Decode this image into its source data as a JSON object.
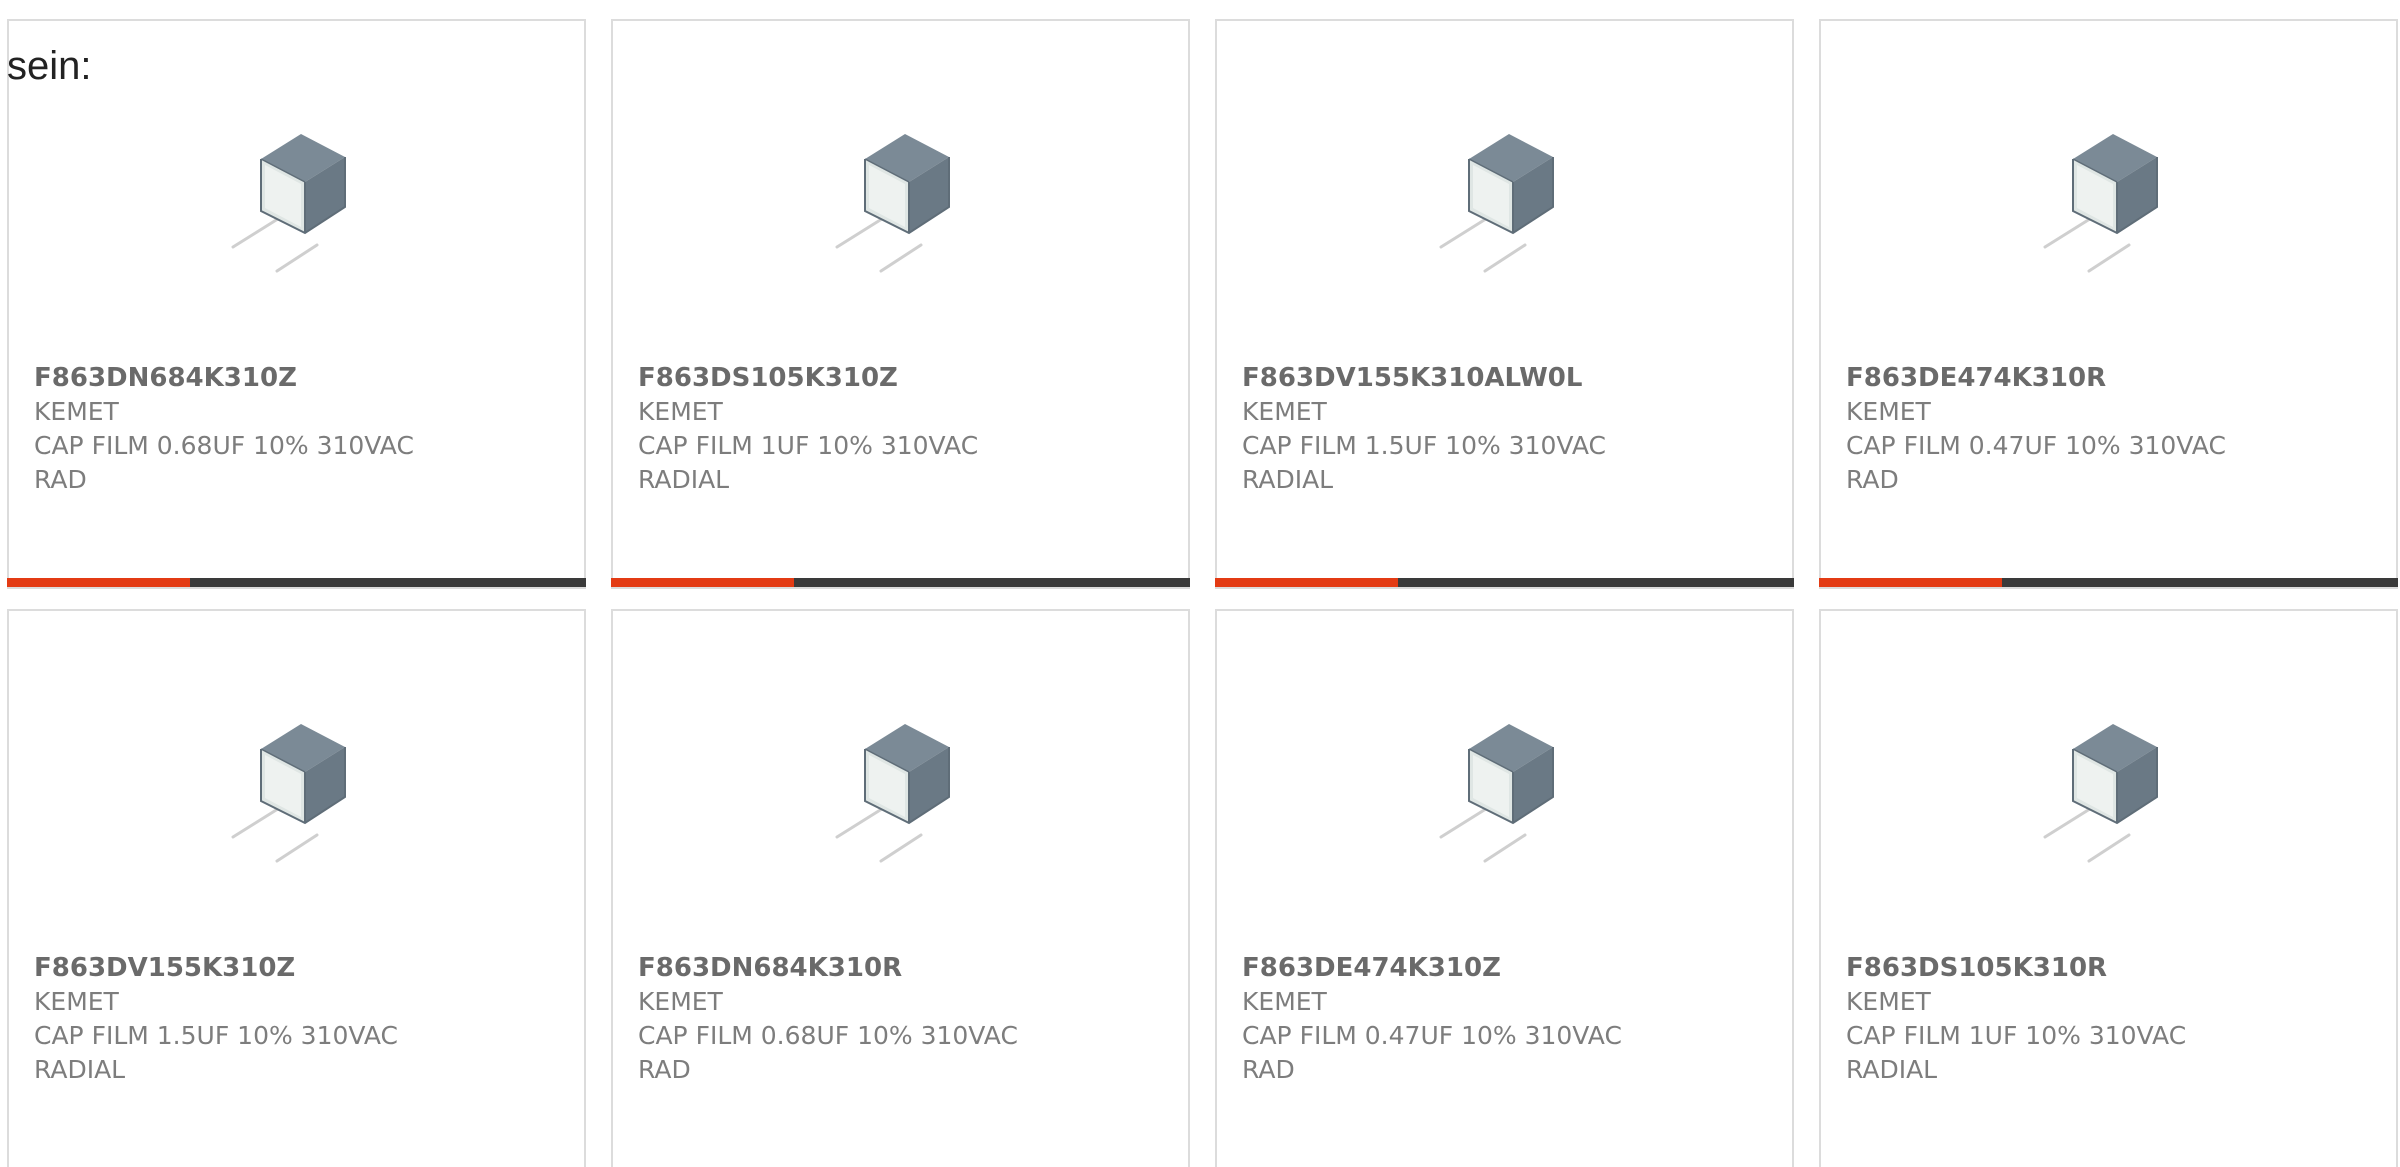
{
  "intro_text": "sein:",
  "colors": {
    "accent": "#e33b14",
    "bar": "#3a3a3a",
    "border": "#dcdcdc",
    "text": "#7d7d7d"
  },
  "products": [
    {
      "part": "F863DN684K310Z",
      "brand": "KEMET",
      "desc1": "CAP FILM 0.68UF 10% 310VAC",
      "desc2": "RAD",
      "image_icon": "film-capacitor-icon",
      "show_bar": true
    },
    {
      "part": "F863DS105K310Z",
      "brand": "KEMET",
      "desc1": "CAP FILM 1UF 10% 310VAC",
      "desc2": "RADIAL",
      "image_icon": "film-capacitor-icon",
      "show_bar": true
    },
    {
      "part": "F863DV155K310ALW0L",
      "brand": "KEMET",
      "desc1": "CAP FILM 1.5UF 10% 310VAC",
      "desc2": "RADIAL",
      "image_icon": "film-capacitor-icon",
      "show_bar": true
    },
    {
      "part": "F863DE474K310R",
      "brand": "KEMET",
      "desc1": "CAP FILM 0.47UF 10% 310VAC",
      "desc2": "RAD",
      "image_icon": "film-capacitor-icon",
      "show_bar": true
    },
    {
      "part": "F863DV155K310Z",
      "brand": "KEMET",
      "desc1": "CAP FILM 1.5UF 10% 310VAC",
      "desc2": "RADIAL",
      "image_icon": "film-capacitor-icon",
      "show_bar": false
    },
    {
      "part": "F863DN684K310R",
      "brand": "KEMET",
      "desc1": "CAP FILM 0.68UF 10% 310VAC",
      "desc2": "RAD",
      "image_icon": "film-capacitor-icon",
      "show_bar": false
    },
    {
      "part": "F863DE474K310Z",
      "brand": "KEMET",
      "desc1": "CAP FILM 0.47UF 10% 310VAC",
      "desc2": "RAD",
      "image_icon": "film-capacitor-icon",
      "show_bar": false
    },
    {
      "part": "F863DS105K310R",
      "brand": "KEMET",
      "desc1": "CAP FILM 1UF 10% 310VAC",
      "desc2": "RADIAL",
      "image_icon": "film-capacitor-icon",
      "show_bar": false
    }
  ]
}
